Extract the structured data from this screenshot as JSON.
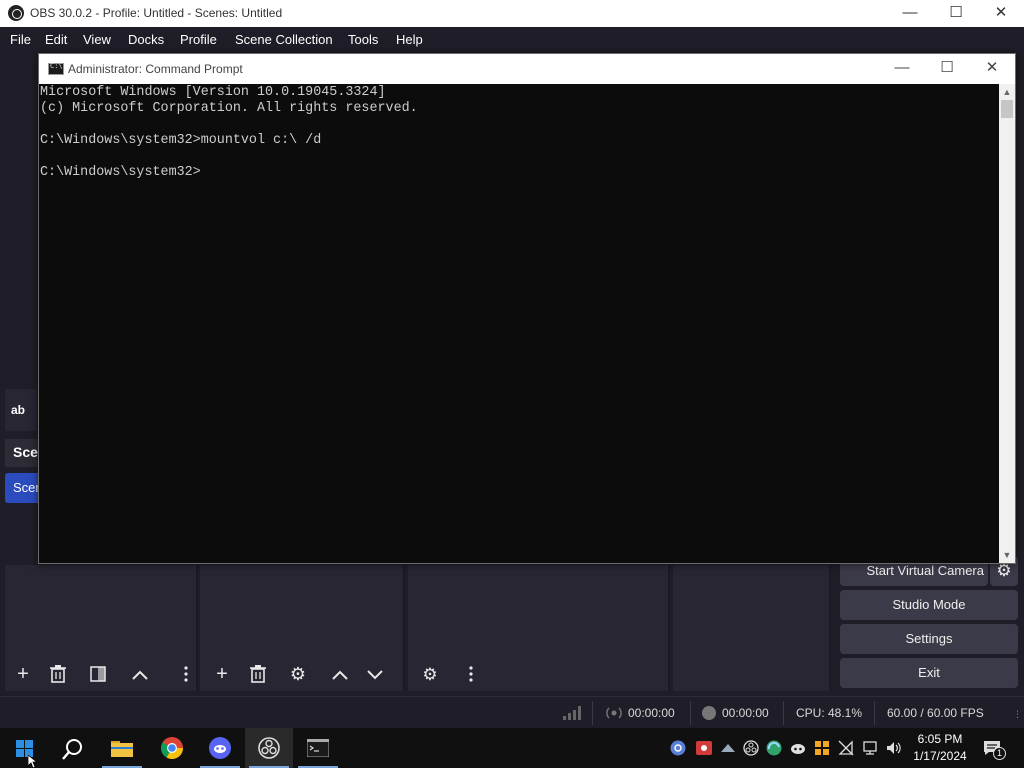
{
  "obs": {
    "title": "OBS 30.0.2 - Profile: Untitled - Scenes: Untitled",
    "menu": [
      "File",
      "Edit",
      "View",
      "Docks",
      "Profile",
      "Scene Collection",
      "Tools",
      "Help"
    ],
    "left_partial": {
      "source_icon_text": "ab",
      "scenes_header": "Scen",
      "scene_item": "Scen"
    },
    "controls": {
      "start_virtual_camera": "Start Virtual Camera",
      "studio_mode": "Studio Mode",
      "settings": "Settings",
      "exit": "Exit"
    },
    "status": {
      "stream_time": "00:00:00",
      "record_time": "00:00:00",
      "cpu": "CPU: 48.1%",
      "fps": "60.00 / 60.00 FPS"
    }
  },
  "cmd": {
    "title": "Administrator: Command Prompt",
    "lines": [
      "Microsoft Windows [Version 10.0.19045.3324]",
      "(c) Microsoft Corporation. All rights reserved.",
      "",
      "C:\\Windows\\system32>mountvol c:\\ /d",
      "",
      "C:\\Windows\\system32>"
    ]
  },
  "taskbar": {
    "time": "6:05 PM",
    "date": "1/17/2024",
    "notification_count": "1"
  },
  "colors": {
    "obs_bg": "#1f1e28",
    "scene_selected": "#2b4cbf",
    "cmd_bg": "#0c0c0c"
  }
}
